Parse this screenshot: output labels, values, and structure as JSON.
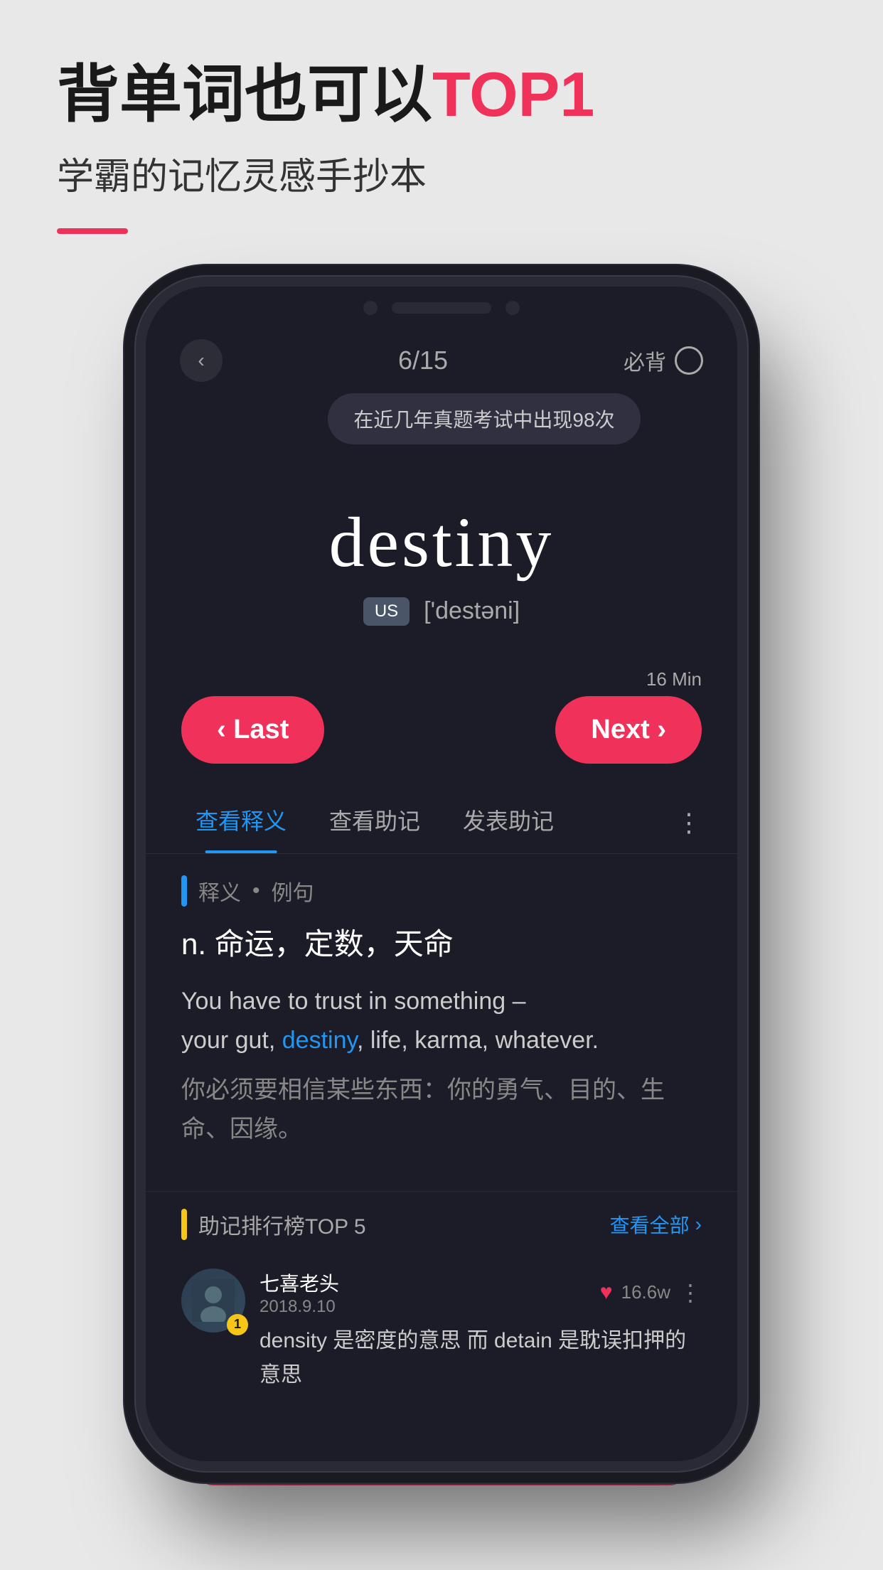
{
  "page": {
    "background_color": "#e8e8e8",
    "headline": {
      "prefix": "背单词也可以",
      "suffix": "TOP1"
    },
    "subheadline": "学霸的记忆灵感手抄本",
    "red_line_visible": true
  },
  "phone": {
    "header": {
      "back_button": "‹",
      "progress": "6/15",
      "must_label": "必背",
      "circle_empty": true
    },
    "tooltip": "在近几年真题考试中出现98次",
    "word": {
      "text": "destiny",
      "pronunciation_badge": "US",
      "phonetic": "['destəni]"
    },
    "nav_buttons": {
      "last_label": "‹ Last",
      "next_label": "Next ›",
      "time_hint": "16 Min"
    },
    "tabs": [
      {
        "label": "查看释义",
        "active": true
      },
      {
        "label": "查看助记",
        "active": false
      },
      {
        "label": "发表助记",
        "active": false
      }
    ],
    "tabs_more": "⋮",
    "content": {
      "section_label": "释义",
      "section_sub": "例句",
      "definition": "n.  命运，定数，天命",
      "example_en_parts": [
        {
          "text": "You have to trust in something –\nyour gut, ",
          "highlight": false
        },
        {
          "text": "destiny",
          "highlight": true
        },
        {
          "text": ", life, karma, whatever.",
          "highlight": false
        }
      ],
      "example_zh": "你必须要相信某些东西：你的勇气、目的、生命、因缘。"
    },
    "mnemonic": {
      "title": "助记排行榜TOP 5",
      "view_all": "查看全部",
      "entries": [
        {
          "rank": 1,
          "username": "七喜老头",
          "date": "2018.9.10",
          "likes": "16.6w",
          "content": "density 是密度的意思  而 detain 是耽误扣押的意思"
        }
      ]
    }
  }
}
